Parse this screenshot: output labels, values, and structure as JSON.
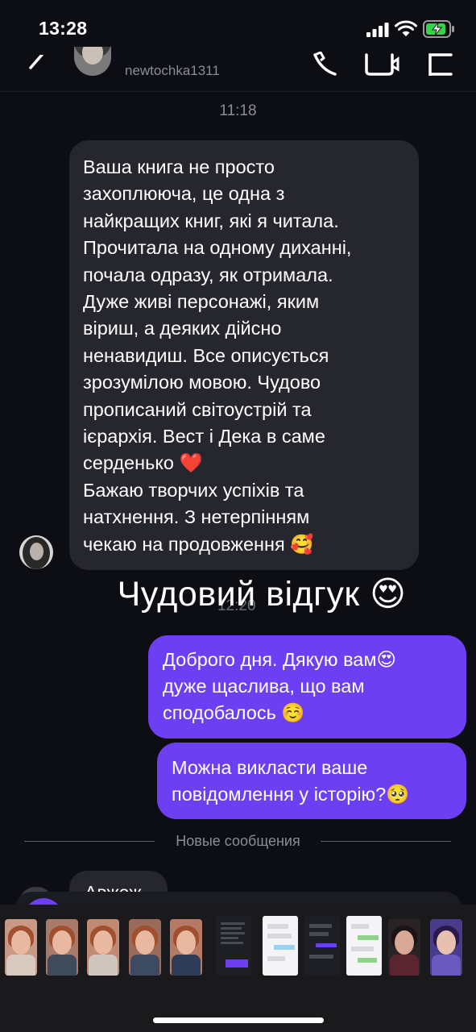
{
  "status_bar": {
    "time": "13:28"
  },
  "header": {
    "username": "newtochka1311"
  },
  "conversation": {
    "timestamp_1": "11:18",
    "incoming_message": {
      "lines": [
        "Ваша книга не просто",
        "захоплююча, це одна з",
        "найкращих книг, які я читала.",
        "Прочитала на одному диханні,",
        "почала одразу, як отримала.",
        "Дуже живі персонажі, яким",
        "віриш, а деяких дійсно",
        "ненавидиш. Все описується",
        "зрозумілою мовою. Чудово",
        "прописаний світоустрій та",
        "ієрархія. Вест і Дека в саме",
        "серденько ❤️",
        "Бажаю творчих успіхів та",
        "натхнення. З нетерпінням",
        "чекаю на продовження 🥰"
      ]
    },
    "overlay_caption": "Чудовий відгук 😍",
    "timestamp_2_partial": "12:20",
    "outgoing_message_1": {
      "lines": [
        "Доброго дня. Дякую вам😍",
        "дуже щаслива, що вам",
        "сподобалось ☺️"
      ]
    },
    "outgoing_message_2": {
      "lines": [
        "Можна викласти ваше",
        "повідомлення у історію?🥺"
      ]
    },
    "new_messages_label": "Новые сообщения",
    "partial_incoming": "Авжеж"
  },
  "colors": {
    "background": "#0d0e13",
    "incoming_bubble": "#26272e",
    "outgoing_bubble": "#6d3ff2",
    "muted_text": "#8b8d94"
  },
  "photo_tray": {
    "items": [
      "photo-1",
      "photo-2",
      "photo-3",
      "photo-4",
      "photo-5",
      "screenshot-1",
      "screenshot-2",
      "screenshot-3",
      "screenshot-4",
      "photo-6",
      "photo-7"
    ]
  }
}
